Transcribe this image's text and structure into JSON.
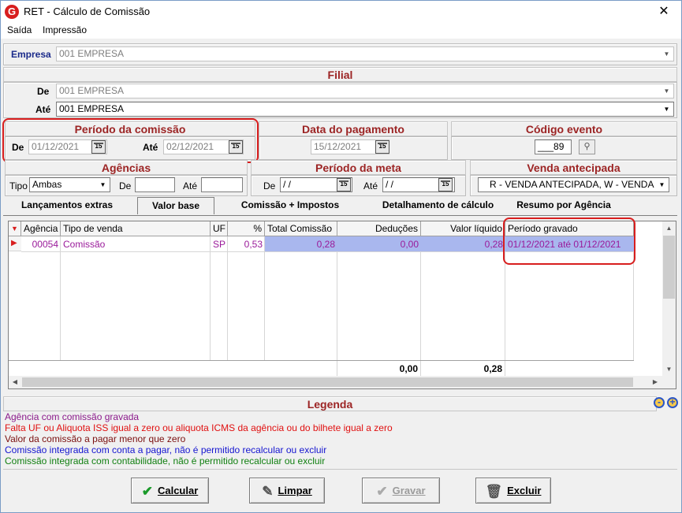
{
  "window": {
    "title": "RET - Cálculo de Comissão",
    "close": "✕"
  },
  "menu": [
    "Saída",
    "Impressão"
  ],
  "empresa": {
    "label": "Empresa",
    "value": "001 EMPRESA"
  },
  "filial": {
    "title": "Filial",
    "de_label": "De",
    "de_value": "001 EMPRESA",
    "ate_label": "Até",
    "ate_value": "001 EMPRESA"
  },
  "periodo_comissao": {
    "title": "Período da comissão",
    "de_label": "De",
    "de_value": "01/12/2021",
    "ate_label": "Até",
    "ate_value": "02/12/2021"
  },
  "data_pagamento": {
    "title": "Data do pagamento",
    "value": "15/12/2021"
  },
  "codigo_evento": {
    "title": "Código evento",
    "value": "___89"
  },
  "agencias": {
    "title": "Agências",
    "tipo_label": "Tipo",
    "tipo_value": "Ambas",
    "de_label": "De",
    "ate_label": "Até"
  },
  "periodo_meta": {
    "title": "Período da meta",
    "de_label": "De",
    "de_value": " / /",
    "ate_label": "Até",
    "ate_value": " / /"
  },
  "venda_antecipada": {
    "title": "Venda antecipada",
    "value": "R  - VENDA ANTECIPADA,   W  - VENDA"
  },
  "calendar_icon_text": "15",
  "tabs": [
    "Lançamentos extras",
    "Valor base",
    "Comissão + Impostos",
    "Detalhamento de cálculo",
    "Resumo por Agência"
  ],
  "grid": {
    "headers": [
      "Agência",
      "Tipo de venda",
      "UF",
      "%",
      "Total Comissão",
      "Deduções",
      "Valor líquido",
      "Período gravado"
    ],
    "rows": [
      {
        "agencia": "00054",
        "tipo": "Comissão",
        "uf": "SP",
        "pct": "0,53",
        "total": "0,28",
        "deducoes": "0,00",
        "liquido": "0,28",
        "periodo": "01/12/2021 até 01/12/2021"
      }
    ],
    "totals": {
      "deducoes": "0,00",
      "liquido": "0,28"
    }
  },
  "legend": {
    "title": "Legenda",
    "items": [
      {
        "text": "Agência com comissão gravada",
        "color": "#8b1a8b"
      },
      {
        "text": "Falta UF ou Aliquota ISS igual a zero ou aliquota ICMS da agência ou do bilhete igual a zero",
        "color": "#e01010"
      },
      {
        "text": "Valor da comissão a pagar menor que zero",
        "color": "#7a0f0f"
      },
      {
        "text": "Comissão integrada com conta a pagar, não é permitido recalcular ou excluir",
        "color": "#1515d0"
      },
      {
        "text": "Comissão integrada com contabilidade, não é permitido recalcular ou excluir",
        "color": "#128012"
      }
    ]
  },
  "buttons": {
    "calcular": "Calcular",
    "limpar": "Limpar",
    "gravar": "Gravar",
    "excluir": "Excluir"
  },
  "colors": {
    "section_title": "#9c2424",
    "highlight": "#d81e1e",
    "row_selected": "#a9b7ee"
  }
}
